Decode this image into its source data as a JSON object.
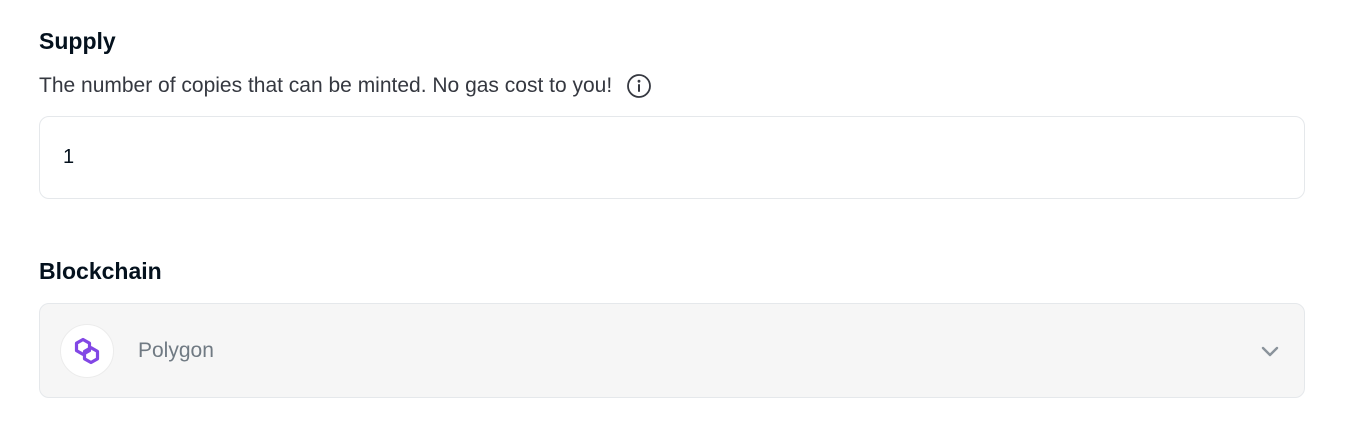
{
  "supply": {
    "label": "Supply",
    "description": "The number of copies that can be minted. No gas cost to you!",
    "info_icon": "info-circle-icon",
    "value": "1"
  },
  "blockchain": {
    "label": "Blockchain",
    "selected": "Polygon",
    "logo_icon": "polygon-logo-icon",
    "dropdown_icon": "chevron-down-icon"
  },
  "colors": {
    "polygon_purple": "#8247e5",
    "select_background": "#f6f6f6",
    "border": "#e5e8eb"
  }
}
